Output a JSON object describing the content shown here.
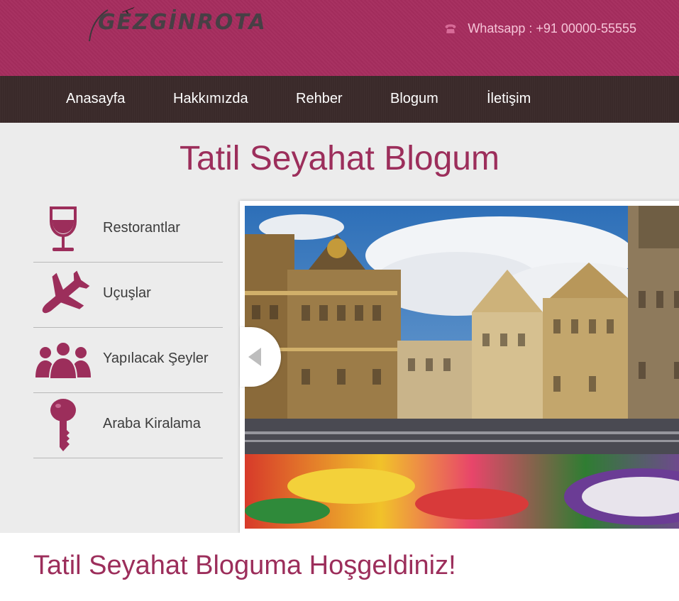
{
  "header": {
    "logo_text": "GEZGİNROTA",
    "contact_text": "Whatsapp : +91 00000-55555",
    "icon": "phone-icon"
  },
  "nav": {
    "items": [
      {
        "label": "Anasayfa"
      },
      {
        "label": "Hakkımızda"
      },
      {
        "label": "Rehber"
      },
      {
        "label": "Blogum"
      },
      {
        "label": "İletişim"
      }
    ]
  },
  "main": {
    "title": "Tatil Seyahat Blogum"
  },
  "categories": [
    {
      "label": "Restorantlar",
      "icon": "wine-glass-icon"
    },
    {
      "label": "Uçuşlar",
      "icon": "airplane-icon"
    },
    {
      "label": "Yapılacak Şeyler",
      "icon": "people-group-icon"
    },
    {
      "label": "Araba Kiralama",
      "icon": "key-icon"
    }
  ],
  "slider": {
    "prev_icon": "chevron-left-icon"
  },
  "welcome": {
    "heading": "Tatil Seyahat Bloguma Hoşgeldiniz!"
  },
  "colors": {
    "brand": "#a62d5e",
    "nav_bg": "#3a2a2a",
    "accent_text": "#9c2e5b"
  }
}
